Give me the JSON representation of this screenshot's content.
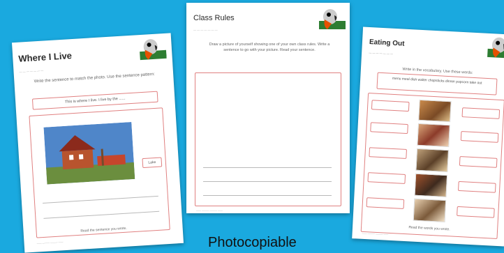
{
  "sheets": {
    "where_i_live": {
      "title": "Where I Live",
      "instruction": "Write the sentence to match the photo. Use the sentence pattern:",
      "pattern": "This is where I live. I live by the ......",
      "label": "Lake",
      "footer_text": "Read the sentence you wrote."
    },
    "class_rules": {
      "title": "Class Rules",
      "instruction": "Draw a picture of yourself showing one of your own class rules. Write a sentence to go with your picture. Read your sentence."
    },
    "eating_out": {
      "title": "Eating Out",
      "instruction": "Write in the vocabulary. Use these words:",
      "words": "menu  meal  dish  waiter  chopsticks  dinner  popcorn  take out",
      "footer_text": "Read the words you wrote."
    }
  },
  "caption": "Photocopiable"
}
